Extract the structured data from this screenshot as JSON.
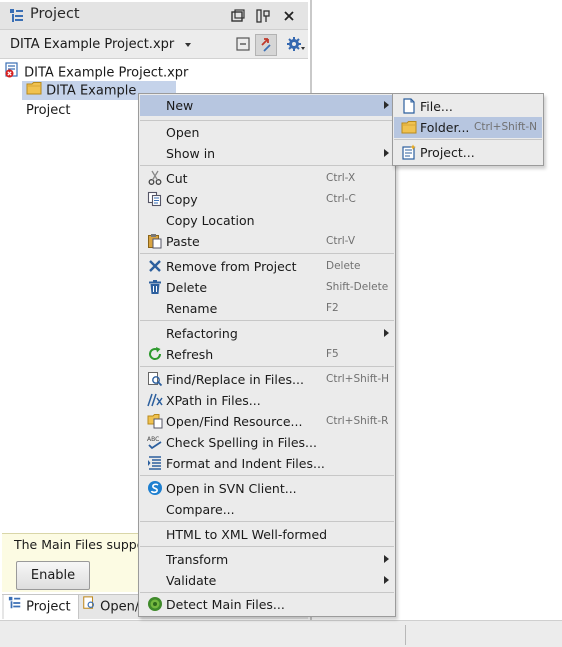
{
  "panel": {
    "title": "Project",
    "project_name": "DITA Example Project.xpr",
    "tree": {
      "root_label": "DITA Example Project.xpr",
      "folder_label": "DITA Example Project"
    },
    "notice_text": "The Main Files suppo",
    "enable_label": "Enable",
    "tabs": [
      "Project",
      "Open/I"
    ]
  },
  "context_menu": {
    "items": [
      {
        "label": "New",
        "shortcut": "",
        "icon": "",
        "submenu": true
      },
      {
        "label": "Open",
        "shortcut": "",
        "icon": "",
        "submenu": false
      },
      {
        "label": "Show in",
        "shortcut": "",
        "icon": "",
        "submenu": true
      },
      {
        "label": "Cut",
        "shortcut": "Ctrl-X",
        "icon": "scissors-icon",
        "submenu": false
      },
      {
        "label": "Copy",
        "shortcut": "Ctrl-C",
        "icon": "copy-icon",
        "submenu": false
      },
      {
        "label": "Copy Location",
        "shortcut": "",
        "icon": "",
        "submenu": false
      },
      {
        "label": "Paste",
        "shortcut": "Ctrl-V",
        "icon": "paste-icon",
        "submenu": false
      },
      {
        "label": "Remove from Project",
        "shortcut": "Delete",
        "icon": "remove-icon",
        "submenu": false
      },
      {
        "label": "Delete",
        "shortcut": "Shift-Delete",
        "icon": "trash-icon",
        "submenu": false
      },
      {
        "label": "Rename",
        "shortcut": "F2",
        "icon": "",
        "submenu": false
      },
      {
        "label": "Refactoring",
        "shortcut": "",
        "icon": "",
        "submenu": true
      },
      {
        "label": "Refresh",
        "shortcut": "F5",
        "icon": "refresh-icon",
        "submenu": false
      },
      {
        "label": "Find/Replace in Files...",
        "shortcut": "Ctrl+Shift-H",
        "icon": "find-replace-icon",
        "submenu": false
      },
      {
        "label": "XPath in Files...",
        "shortcut": "",
        "icon": "xpath-icon",
        "submenu": false
      },
      {
        "label": "Open/Find Resource...",
        "shortcut": "Ctrl+Shift-R",
        "icon": "open-find-resource-icon",
        "submenu": false
      },
      {
        "label": "Check Spelling in Files...",
        "shortcut": "",
        "icon": "spellcheck-icon",
        "submenu": false
      },
      {
        "label": "Format and Indent Files...",
        "shortcut": "",
        "icon": "format-indent-icon",
        "submenu": false
      },
      {
        "label": "Open in SVN Client...",
        "shortcut": "",
        "icon": "svn-icon",
        "submenu": false
      },
      {
        "label": "Compare...",
        "shortcut": "",
        "icon": "",
        "submenu": false
      },
      {
        "label": "HTML to XML Well-formed",
        "shortcut": "",
        "icon": "",
        "submenu": false
      },
      {
        "label": "Transform",
        "shortcut": "",
        "icon": "",
        "submenu": true
      },
      {
        "label": "Validate",
        "shortcut": "",
        "icon": "",
        "submenu": true
      },
      {
        "label": "Detect Main Files...",
        "shortcut": "",
        "icon": "detect-main-files-icon",
        "submenu": false
      }
    ]
  },
  "submenu": {
    "items": [
      {
        "label": "File...",
        "shortcut": "",
        "icon": "file-icon"
      },
      {
        "label": "Folder...",
        "shortcut": "Ctrl+Shift-N",
        "icon": "folder-icon"
      },
      {
        "label": "Project...",
        "shortcut": "",
        "icon": "project-icon"
      }
    ]
  },
  "colors": {
    "highlight": "#b7c6e0",
    "menu_background": "#ebebeb",
    "notice_background": "#fcfbe3",
    "folder_yellow": "#f0c250"
  }
}
